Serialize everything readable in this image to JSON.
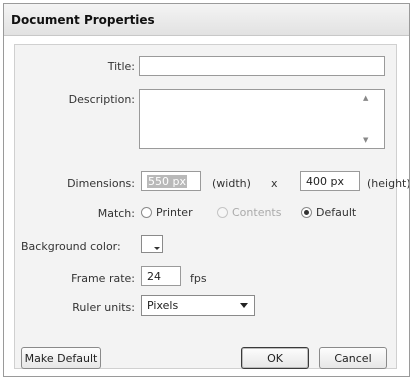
{
  "window": {
    "title": "Document Properties"
  },
  "fields": {
    "title": {
      "label": "Title:",
      "value": ""
    },
    "description": {
      "label": "Description:",
      "value": ""
    },
    "dimensions": {
      "label": "Dimensions:",
      "width_value": "550 px",
      "width_unit": "(width)",
      "separator": "x",
      "height_value": "400 px",
      "height_unit": "(height)"
    },
    "match": {
      "label": "Match:",
      "options": [
        {
          "label": "Printer",
          "selected": false,
          "disabled": false
        },
        {
          "label": "Contents",
          "selected": false,
          "disabled": true
        },
        {
          "label": "Default",
          "selected": true,
          "disabled": false
        }
      ]
    },
    "background_color": {
      "label": "Background color:",
      "color": "#ffffff"
    },
    "frame_rate": {
      "label": "Frame rate:",
      "value": "24",
      "unit": "fps"
    },
    "ruler_units": {
      "label": "Ruler units:",
      "selected": "Pixels"
    }
  },
  "buttons": {
    "make_default": "Make Default",
    "ok": "OK",
    "cancel": "Cancel"
  }
}
